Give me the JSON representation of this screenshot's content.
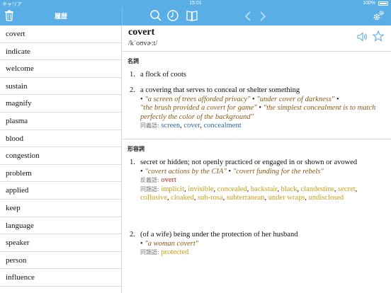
{
  "status": {
    "carrier": "キャリア",
    "time": "15:01",
    "battery": "100%"
  },
  "toolbar": {
    "history_title": "履歴",
    "icons": [
      "trash-icon",
      "search-icon",
      "history-icon",
      "book-icon",
      "back-icon",
      "forward-icon",
      "settings-icon"
    ]
  },
  "sidebar": {
    "items": [
      "covert",
      "indicate",
      "welcome",
      "sustain",
      "magnify",
      "plasma",
      "blood",
      "congestion",
      "problem",
      "applied",
      "keep",
      "language",
      "speaker",
      "person",
      "influence"
    ]
  },
  "entry": {
    "headword": "covert",
    "pronunciation": "/kˈoʊvɚ:t/",
    "noun": {
      "label": "名詞",
      "senses": [
        {
          "num": "1.",
          "def": "a flock of coots"
        },
        {
          "num": "2.",
          "def": "a covering that serves to conceal or shelter something",
          "ex1": "\"a screen of trees afforded privacy\"",
          "ex2": "\"under cover of darkness\"",
          "ex3": "\"the brush provided a covert for game\"",
          "ex4": "\"the simplest concealment is to match perfectly the color of the background\"",
          "syn_label": "同義語:",
          "syn1": "screen",
          "syn2": "cover",
          "syn3": "concealment"
        }
      ]
    },
    "adjective": {
      "label": "形容詞",
      "senses": [
        {
          "num": "1.",
          "def": "secret or hidden; not openly practiced or engaged in or shown or avowed",
          "ex1": "\"covert actions by the CIA\"",
          "ex2": "\"covert funding for the rebels\"",
          "ant_label": "反義語:",
          "ant1": "overt",
          "rel_label": "同類語:",
          "rel": [
            "implicit",
            "invisible",
            "concealed",
            "backstair",
            "black",
            "clandestine",
            "secret",
            "collusive",
            "cloaked",
            "sub-rosa",
            "subterranean",
            "under wraps",
            "undisclosed"
          ]
        },
        {
          "num": "2.",
          "def": "(of a wife) being under the protection of her husband",
          "ex1": "\"a woman covert\"",
          "rel_label": "同類語:",
          "rel1": "protected"
        }
      ]
    }
  },
  "colors": {
    "toolbar": "#5aaee6",
    "example": "#8a5a16",
    "synonym": "#2e6da8",
    "antonym": "#c02020",
    "related": "#c99e14"
  }
}
